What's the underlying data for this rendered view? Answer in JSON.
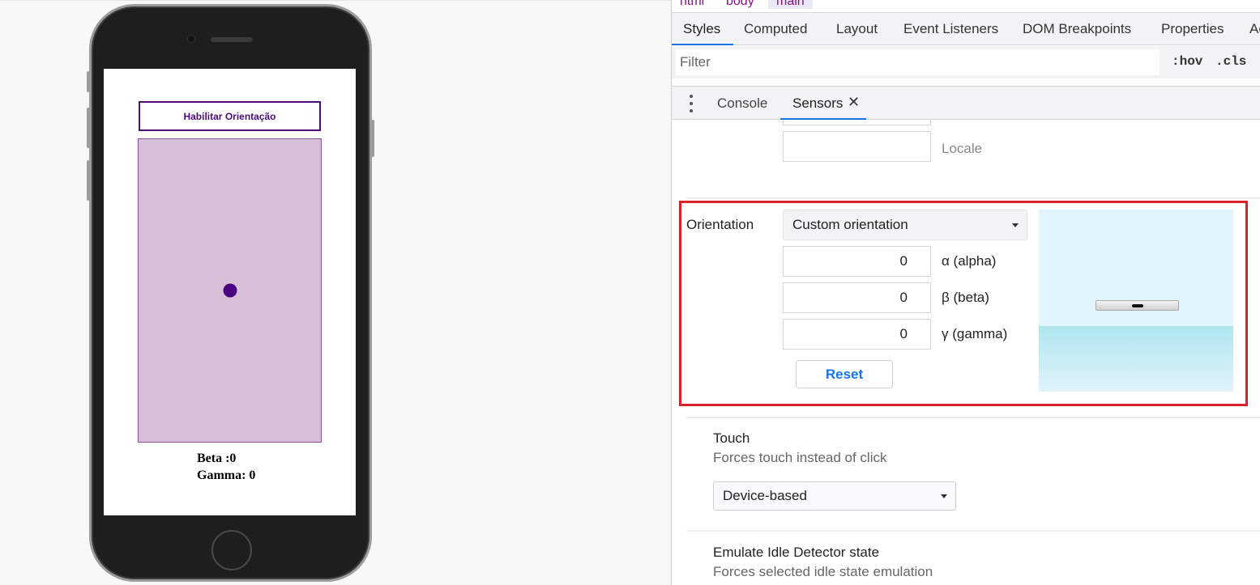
{
  "phone_page": {
    "enable_button": "Habilitar Orientação",
    "ball_position": {
      "beta": 0,
      "gamma": 0
    },
    "beta_text": "Beta :0",
    "gamma_text": "Gamma: 0",
    "colors": {
      "accent": "#4b0082",
      "area_fill": "#d8bfd8"
    }
  },
  "devtools": {
    "breadcrumb": [
      "html",
      "body",
      "main"
    ],
    "tabs": [
      "Styles",
      "Computed",
      "Layout",
      "Event Listeners",
      "DOM Breakpoints",
      "Properties",
      "Accessibility"
    ],
    "active_tab": "Styles",
    "filter": {
      "placeholder": "Filter",
      "value": ""
    },
    "pseudo_buttons": [
      ":hov",
      ".cls"
    ],
    "drawer": {
      "tabs": [
        "Console",
        "Sensors"
      ],
      "active_tab": "Sensors",
      "close_glyph": "✕"
    },
    "sensors": {
      "locale_label": "Locale",
      "locale_value": "",
      "orientation": {
        "label": "Orientation",
        "selected": "Custom orientation",
        "alpha": {
          "value": "0",
          "label": "α (alpha)"
        },
        "beta": {
          "value": "0",
          "label": "β (beta)"
        },
        "gamma": {
          "value": "0",
          "label": "γ (gamma)"
        },
        "reset_label": "Reset"
      },
      "touch": {
        "title": "Touch",
        "description": "Forces touch instead of click",
        "selected": "Device-based"
      },
      "idle": {
        "title": "Emulate Idle Detector state",
        "description": "Forces selected idle state emulation"
      }
    }
  }
}
